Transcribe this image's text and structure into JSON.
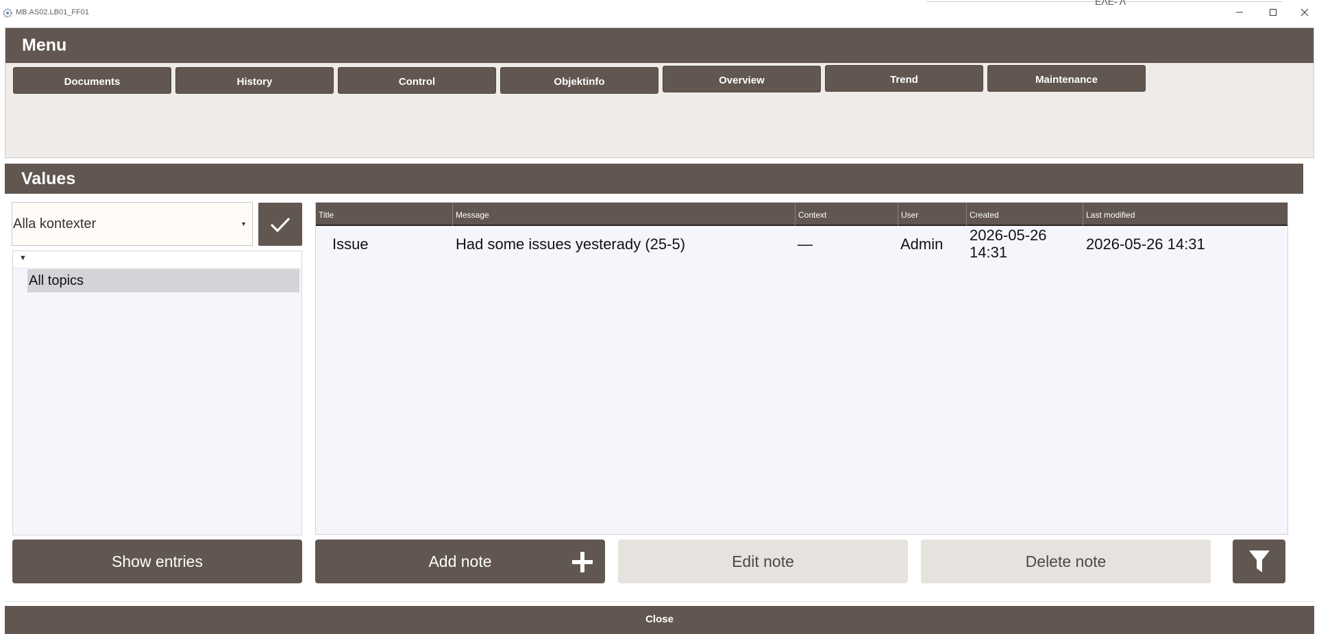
{
  "window": {
    "title": "MB.AS02.LB01_FF01",
    "background_fragment": "ΕΛΕ- Λ"
  },
  "menu": {
    "header": "Menu",
    "buttons": [
      "Documents",
      "History",
      "Control",
      "Objektinfo",
      "Overview",
      "Trend",
      "Maintenance"
    ]
  },
  "values": {
    "header": "Values",
    "context_select": {
      "value": "Alla kontexter"
    },
    "tree": {
      "items": [
        "All topics"
      ]
    },
    "table": {
      "columns": [
        "Title",
        "Message",
        "Context",
        "User",
        "Created",
        "Last modified"
      ],
      "rows": [
        {
          "title": "Issue",
          "message": "Had some issues yesterady (25-5)",
          "context": "—",
          "user": "Admin",
          "created_date": "2026-05-26",
          "created_time": "14:31",
          "last_modified": "2026-05-26 14:31"
        }
      ]
    },
    "actions": {
      "show_entries": "Show entries",
      "add_note": "Add note",
      "edit_note": "Edit note",
      "delete_note": "Delete note"
    }
  },
  "footer": {
    "close": "Close"
  },
  "colors": {
    "accent": "#615650",
    "disabled_button": "#e6e2de",
    "panel_background": "#efebe9",
    "grid_background": "#f4f6fb"
  },
  "icons": [
    "gear-icon",
    "minimize-icon",
    "maximize-icon",
    "close-icon",
    "checkmark-icon",
    "chevron-down-icon",
    "plus-icon",
    "filter-icon"
  ]
}
